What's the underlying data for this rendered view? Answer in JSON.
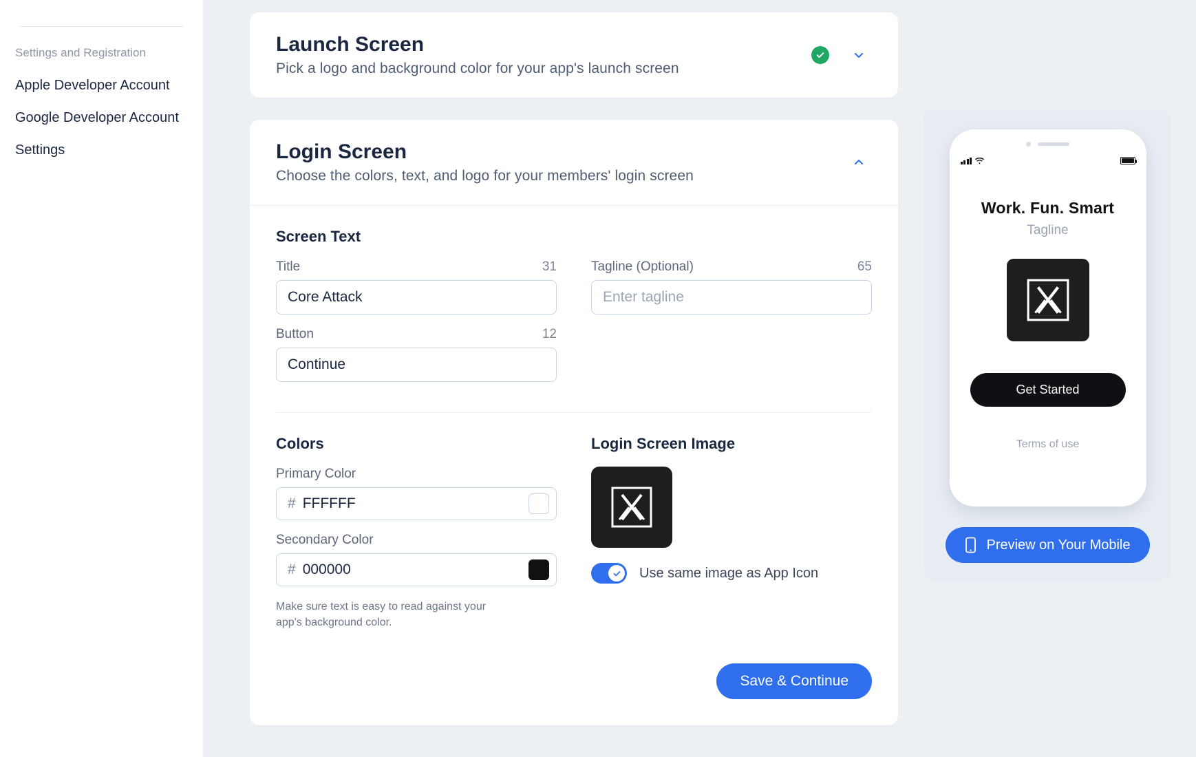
{
  "sidebar": {
    "section_label": "Settings and Registration",
    "items": [
      {
        "label": "Apple Developer Account"
      },
      {
        "label": "Google Developer Account"
      },
      {
        "label": "Settings"
      }
    ]
  },
  "cards": {
    "launch": {
      "title": "Launch Screen",
      "subtitle": "Pick a logo and background color for your app's launch screen",
      "complete": true,
      "expanded": false
    },
    "login": {
      "title": "Login Screen",
      "subtitle": "Choose the colors, text, and logo for your members' login screen",
      "expanded": true,
      "screen_text_heading": "Screen Text",
      "fields": {
        "title": {
          "label": "Title",
          "counter": "31",
          "value": "Core Attack"
        },
        "tagline": {
          "label": "Tagline (Optional)",
          "counter": "65",
          "value": "",
          "placeholder": "Enter tagline"
        },
        "button": {
          "label": "Button",
          "counter": "12",
          "value": "Continue"
        }
      },
      "colors_heading": "Colors",
      "colors": {
        "primary": {
          "label": "Primary Color",
          "hex": "FFFFFF"
        },
        "secondary": {
          "label": "Secondary Color",
          "hex": "000000"
        }
      },
      "colors_help": "Make sure text is easy to read against your app's background color.",
      "image_heading": "Login Screen Image",
      "use_same_toggle_label": "Use same image as App Icon",
      "use_same_toggle_on": true,
      "save_button": "Save & Continue"
    }
  },
  "preview": {
    "title": "Work. Fun. Smart",
    "tagline": "Tagline",
    "button": "Get Started",
    "terms": "Terms of use",
    "mobile_button": "Preview on Your Mobile"
  }
}
